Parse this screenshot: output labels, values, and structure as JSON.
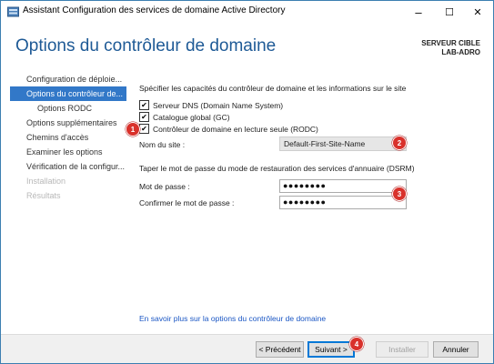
{
  "window": {
    "title": "Assistant Configuration des services de domaine Active Directory",
    "controls": {
      "minimize": "–",
      "maximize": "☐",
      "close": "✕"
    }
  },
  "header": {
    "page_title": "Options du contrôleur de domaine",
    "server_label": "SERVEUR CIBLE",
    "server_name": "LAB-ADRO"
  },
  "sidebar": {
    "items": [
      {
        "label": "Configuration de déploie...",
        "state": "normal"
      },
      {
        "label": "Options du contrôleur de...",
        "state": "active"
      },
      {
        "label": "Options RODC",
        "state": "sub"
      },
      {
        "label": "Options supplémentaires",
        "state": "normal"
      },
      {
        "label": "Chemins d'accès",
        "state": "normal"
      },
      {
        "label": "Examiner les options",
        "state": "normal"
      },
      {
        "label": "Vérification de la configur...",
        "state": "normal"
      },
      {
        "label": "Installation",
        "state": "disabled"
      },
      {
        "label": "Résultats",
        "state": "disabled"
      }
    ]
  },
  "main": {
    "capabilities_text": "Spécifier les capacités du contrôleur de domaine et les informations sur le site",
    "checkboxes": [
      {
        "label": "Serveur DNS (Domain Name System)",
        "checked": true
      },
      {
        "label": "Catalogue global (GC)",
        "checked": true
      },
      {
        "label": "Contrôleur de domaine en lecture seule (RODC)",
        "checked": true
      }
    ],
    "site_label": "Nom du site :",
    "site_value": "Default-First-Site-Name",
    "dsrm_text": "Taper le mot de passe du mode de restauration des services d'annuaire (DSRM)",
    "password_label": "Mot de passe :",
    "password_value": "●●●●●●●●",
    "confirm_label": "Confirmer le mot de passe :",
    "confirm_value": "●●●●●●●●",
    "learn_more": "En savoir plus sur la options du contrôleur de domaine"
  },
  "footer": {
    "previous": "< Précédent",
    "next": "Suivant >",
    "install": "Installer",
    "cancel": "Annuler"
  },
  "annotations": [
    "1",
    "2",
    "3",
    "4"
  ],
  "colors": {
    "accent": "#3278c8",
    "title": "#1e5a96",
    "badge": "#d9312b",
    "link": "#1a56c4"
  }
}
